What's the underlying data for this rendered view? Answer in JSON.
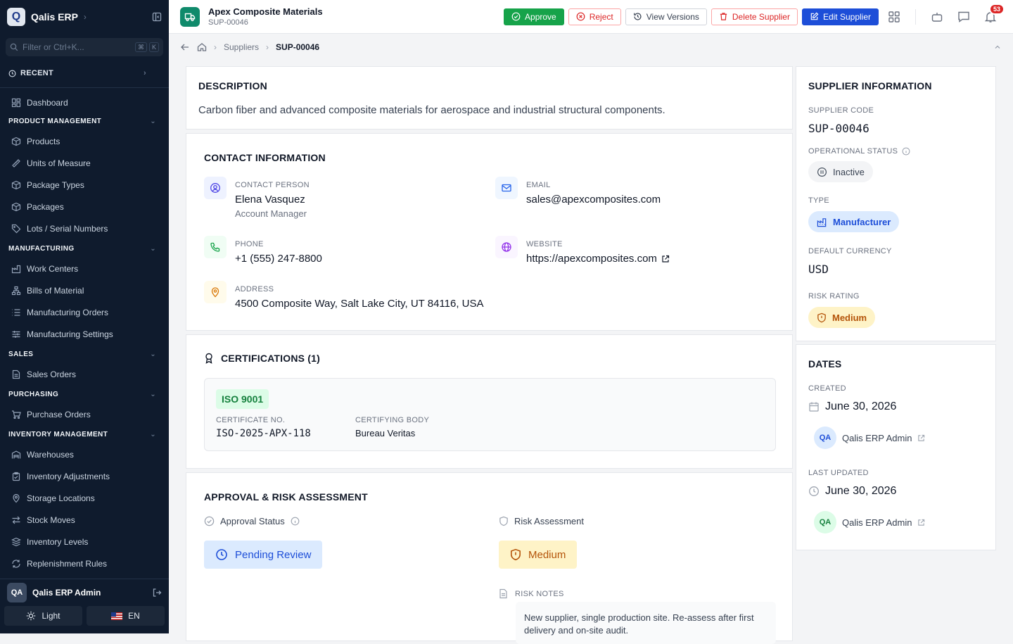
{
  "sidebar": {
    "app_name": "Qalis ERP",
    "logo_letter": "Q",
    "filter_placeholder": "Filter or Ctrl+K...",
    "kbd": [
      "⌘",
      "K"
    ],
    "recent_label": "RECENT",
    "dashboard": "Dashboard",
    "sections": [
      {
        "title": "PRODUCT MANAGEMENT",
        "items": [
          "Products",
          "Units of Measure",
          "Package Types",
          "Packages",
          "Lots / Serial Numbers"
        ]
      },
      {
        "title": "MANUFACTURING",
        "items": [
          "Work Centers",
          "Bills of Material",
          "Manufacturing Orders",
          "Manufacturing Settings"
        ]
      },
      {
        "title": "SALES",
        "items": [
          "Sales Orders"
        ]
      },
      {
        "title": "PURCHASING",
        "items": [
          "Purchase Orders"
        ]
      },
      {
        "title": "INVENTORY MANAGEMENT",
        "items": [
          "Warehouses",
          "Inventory Adjustments",
          "Storage Locations",
          "Stock Moves",
          "Inventory Levels",
          "Replenishment Rules"
        ]
      }
    ],
    "user": {
      "initials": "QA",
      "name": "Qalis ERP Admin"
    },
    "theme_label": "Light",
    "lang_label": "EN"
  },
  "topbar": {
    "title": "Apex Composite Materials",
    "subtitle": "SUP-00046",
    "approve": "Approve",
    "reject": "Reject",
    "view_versions": "View Versions",
    "delete": "Delete Supplier",
    "edit": "Edit Supplier",
    "notifications": "53"
  },
  "breadcrumb": {
    "parent": "Suppliers",
    "current": "SUP-00046"
  },
  "description": {
    "heading": "DESCRIPTION",
    "text": "Carbon fiber and advanced composite materials for aerospace and industrial structural components."
  },
  "contact": {
    "heading": "CONTACT INFORMATION",
    "person_label": "CONTACT PERSON",
    "person": "Elena Vasquez",
    "person_role": "Account Manager",
    "email_label": "EMAIL",
    "email": "sales@apexcomposites.com",
    "phone_label": "PHONE",
    "phone": "+1 (555) 247-8800",
    "website_label": "WEBSITE",
    "website": "https://apexcomposites.com",
    "address_label": "ADDRESS",
    "address": "4500 Composite Way, Salt Lake City, UT 84116, USA"
  },
  "certifications": {
    "heading": "CERTIFICATIONS (1)",
    "items": [
      {
        "name": "ISO 9001",
        "cert_no_label": "CERTIFICATE NO.",
        "cert_no": "ISO-2025-APX-118",
        "body_label": "CERTIFYING BODY",
        "body": "Bureau Veritas"
      }
    ]
  },
  "approval": {
    "heading": "APPROVAL & RISK ASSESSMENT",
    "status_label": "Approval Status",
    "status": "Pending Review",
    "risk_label": "Risk Assessment",
    "risk": "Medium",
    "notes_label": "RISK NOTES",
    "notes": "New supplier, single production site. Re-assess after first delivery and on-site audit."
  },
  "supplier_info": {
    "heading": "SUPPLIER INFORMATION",
    "code_label": "SUPPLIER CODE",
    "code": "SUP-00046",
    "op_status_label": "OPERATIONAL STATUS",
    "op_status": "Inactive",
    "type_label": "TYPE",
    "type": "Manufacturer",
    "currency_label": "DEFAULT CURRENCY",
    "currency": "USD",
    "risk_label": "RISK RATING",
    "risk": "Medium"
  },
  "dates": {
    "heading": "DATES",
    "created_label": "CREATED",
    "created": "June 30, 2026",
    "created_by_initials": "QA",
    "created_by": "Qalis ERP Admin",
    "updated_label": "LAST UPDATED",
    "updated": "June 30, 2026",
    "updated_by_initials": "QA",
    "updated_by": "Qalis ERP Admin"
  },
  "colors": {
    "sidebar_bg": "#0f1b2d",
    "primary": "#1d4ed8",
    "approve": "#16a34a",
    "danger": "#dc2626",
    "warning": "#b45309"
  }
}
